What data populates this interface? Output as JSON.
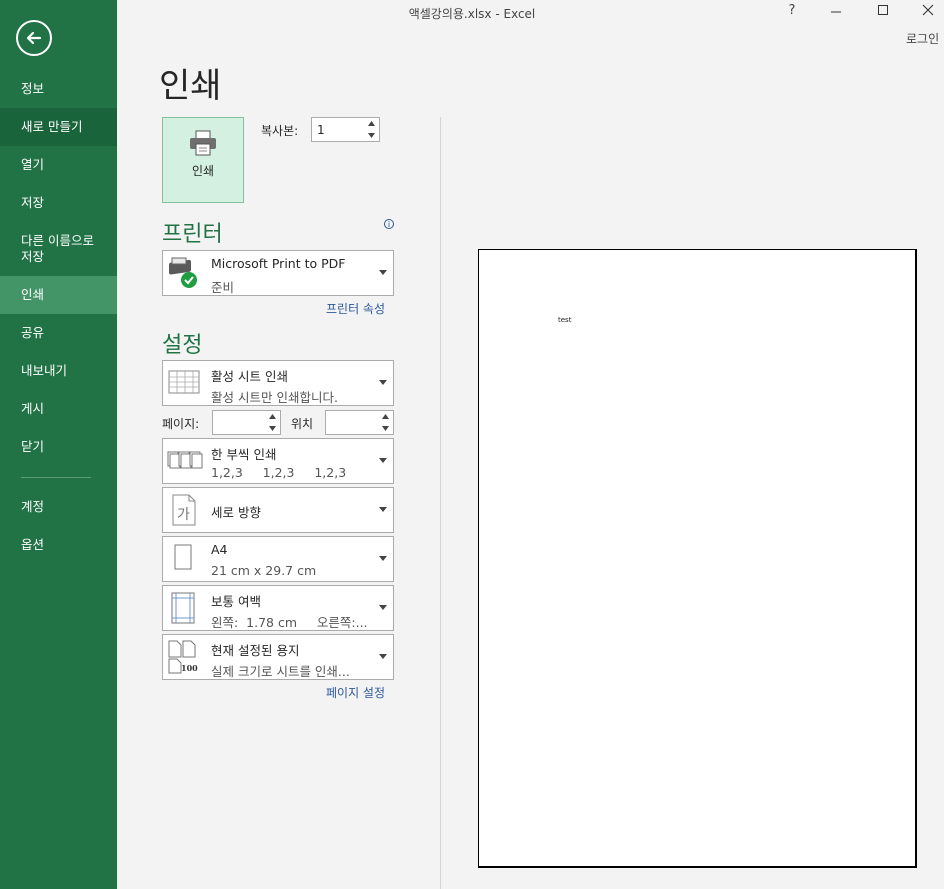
{
  "window": {
    "title": "액셀강의용.xlsx - Excel",
    "help": "?",
    "login": "로그인"
  },
  "sidebar": {
    "items": [
      {
        "label": "정보"
      },
      {
        "label": "새로 만들기"
      },
      {
        "label": "열기"
      },
      {
        "label": "저장"
      },
      {
        "label": "다른 이름으로\n저장"
      },
      {
        "label": "인쇄"
      },
      {
        "label": "공유"
      },
      {
        "label": "내보내기"
      },
      {
        "label": "게시"
      },
      {
        "label": "닫기"
      },
      {
        "label": "계정"
      },
      {
        "label": "옵션"
      }
    ]
  },
  "main": {
    "title": "인쇄",
    "print_button": "인쇄",
    "copies_label": "복사본:",
    "copies_value": "1",
    "printer_section": "프린터",
    "printer": {
      "name": "Microsoft Print to PDF",
      "status": "준비"
    },
    "printer_props_link": "프린터 속성",
    "settings_section": "설정",
    "settings": [
      {
        "main": "활성 시트 인쇄",
        "sub": "활성 시트만 인쇄합니다."
      },
      {
        "main": "한 부씩 인쇄",
        "sub": "1,2,3     1,2,3     1,2,3"
      },
      {
        "main": "세로 방향",
        "sub": ""
      },
      {
        "main": "A4",
        "sub": "21 cm x 29.7 cm"
      },
      {
        "main": "보통 여백",
        "sub": "왼쪽:  1.78 cm     오른쪽:..."
      },
      {
        "main": "현재 설정된 용지",
        "sub": "실제 크기로 시트를 인쇄..."
      }
    ],
    "pages_label": "페이지:",
    "pages_to_label": "위치",
    "page_setup_link": "페이지 설정"
  },
  "preview": {
    "cell_text": "test"
  },
  "colors": {
    "accent": "#217346",
    "sidebar_active": "#439467",
    "link": "#2b579a"
  }
}
